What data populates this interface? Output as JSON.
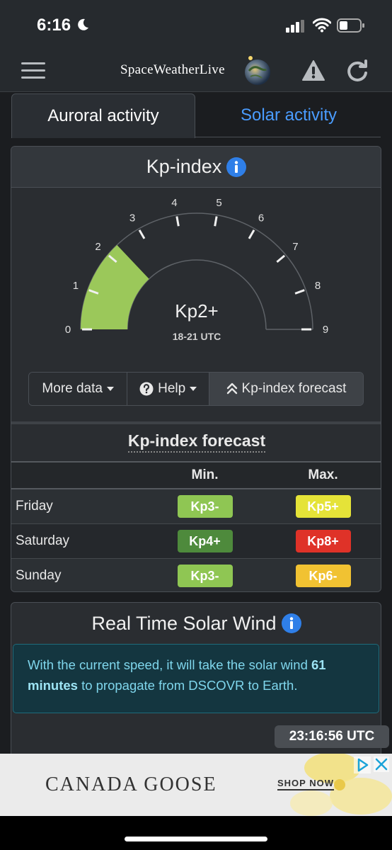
{
  "status_bar": {
    "time": "6:16"
  },
  "header": {
    "logo_text": "SpaceWeatherLive"
  },
  "tabs": [
    {
      "label": "Auroral activity",
      "active": true
    },
    {
      "label": "Solar activity",
      "active": false
    }
  ],
  "kp_card": {
    "title": "Kp-index",
    "gauge": {
      "value_label": "Kp2+",
      "time_label": "18-21 UTC",
      "current_value": 2.33,
      "max": 9,
      "ticks": [
        "0",
        "1",
        "2",
        "3",
        "4",
        "5",
        "6",
        "7",
        "8",
        "9"
      ],
      "fill_color": "#9bc85a"
    },
    "buttons": {
      "more_data": "More data",
      "help": "Help",
      "forecast": "Kp-index forecast"
    },
    "forecast": {
      "title": "Kp-index forecast",
      "col_min": "Min.",
      "col_max": "Max.",
      "rows": [
        {
          "day": "Friday",
          "min": "Kp3-",
          "min_color": "#8fc653",
          "max": "Kp5+",
          "max_color": "#e5e338"
        },
        {
          "day": "Saturday",
          "min": "Kp4+",
          "min_color": "#4e8a3c",
          "max": "Kp8+",
          "max_color": "#df3228"
        },
        {
          "day": "Sunday",
          "min": "Kp3-",
          "min_color": "#8fc653",
          "max": "Kp6-",
          "max_color": "#f1c232"
        }
      ]
    }
  },
  "wind_card": {
    "title": "Real Time Solar Wind",
    "alert_prefix": "With the current speed, it will take the solar wind ",
    "alert_bold": "61 minutes",
    "alert_suffix": " to propagate from DSCOVR to Earth.",
    "time": "23:16:56 UTC"
  },
  "ad": {
    "brand": "CANADA GOOSE",
    "cta": "SHOP NOW"
  },
  "colors": {
    "accent": "#4a9cff",
    "info_blue": "#2f7fe8"
  }
}
